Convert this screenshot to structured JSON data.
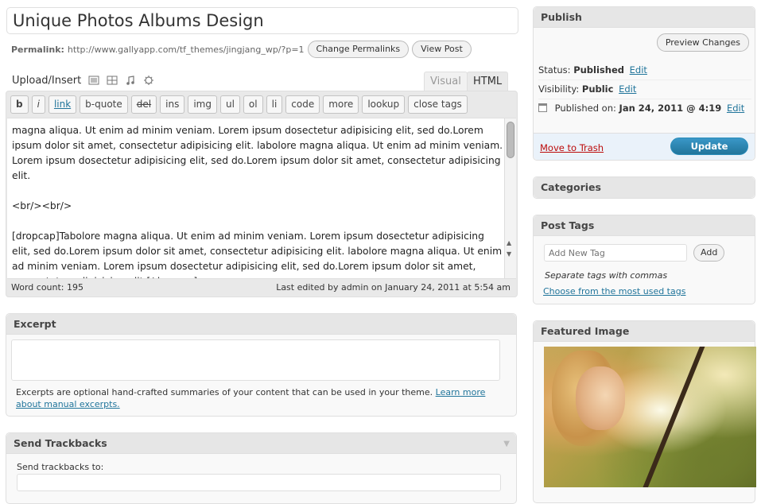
{
  "post": {
    "title": "Unique Photos Albums Design",
    "permalink_label": "Permalink:",
    "permalink_url": "http://www.gallyapp.com/tf_themes/jingjang_wp/?p=1",
    "change_permalinks": "Change Permalinks",
    "view_post": "View Post"
  },
  "media": {
    "label": "Upload/Insert",
    "icons": [
      "image-icon",
      "video-icon",
      "audio-icon",
      "media-icon"
    ]
  },
  "editor": {
    "tabs": {
      "visual": "Visual",
      "html": "HTML"
    },
    "quicktags": [
      "b",
      "i",
      "link",
      "b-quote",
      "del",
      "ins",
      "img",
      "ul",
      "ol",
      "li",
      "code",
      "more",
      "lookup",
      "close tags"
    ],
    "content": "magna aliqua. Ut enim ad minim veniam. Lorem ipsum dosectetur adipisicing elit, sed do.Lorem ipsum dolor sit amet, consectetur adipisicing elit. labolore magna aliqua. Ut enim ad minim veniam. Lorem ipsum dosectetur adipisicing elit, sed do.Lorem ipsum dolor sit amet, consectetur adipisicing elit.\n\n<br/><br/>\n\n[dropcap]Tabolore magna aliqua. Ut enim ad minim veniam. Lorem ipsum dosectetur adipisicing elit, sed do.Lorem ipsum dolor sit amet, consectetur adipisicing elit. labolore magna aliqua. Ut enim ad minim veniam. Lorem ipsum dosectetur adipisicing elit, sed do.Lorem ipsum dolor sit amet, consectetur adipisicing elit.[/dropcap]",
    "word_count": "Word count: 195",
    "last_edited": "Last edited by admin on January 24, 2011 at 5:54 am"
  },
  "excerpt": {
    "title": "Excerpt",
    "help_text": "Excerpts are optional hand-crafted summaries of your content that can be used in your theme.",
    "learn_more": "Learn more about manual excerpts."
  },
  "trackbacks": {
    "title": "Send Trackbacks",
    "label": "Send trackbacks to:"
  },
  "publish": {
    "title": "Publish",
    "preview": "Preview Changes",
    "status_label": "Status:",
    "status_value": "Published",
    "visibility_label": "Visibility:",
    "visibility_value": "Public",
    "published_label": "Published on:",
    "published_value": "Jan 24, 2011 @ 4:19",
    "edit": "Edit",
    "trash": "Move to Trash",
    "update": "Update"
  },
  "categories": {
    "title": "Categories"
  },
  "tags": {
    "title": "Post Tags",
    "placeholder": "Add New Tag",
    "add": "Add",
    "separator_hint": "Separate tags with commas",
    "most_used": "Choose from the most used tags"
  },
  "featured": {
    "title": "Featured Image"
  },
  "colors": {
    "accent": "#21759b",
    "update_button": "#21759b",
    "trash": "#bc0b0b"
  }
}
